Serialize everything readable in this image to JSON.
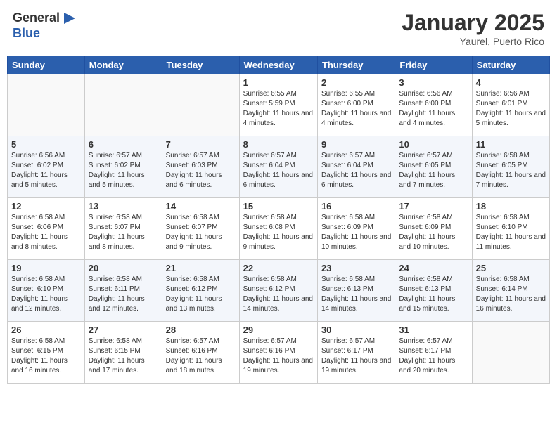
{
  "header": {
    "logo_general": "General",
    "logo_blue": "Blue",
    "month_title": "January 2025",
    "location": "Yaurel, Puerto Rico"
  },
  "weekdays": [
    "Sunday",
    "Monday",
    "Tuesday",
    "Wednesday",
    "Thursday",
    "Friday",
    "Saturday"
  ],
  "weeks": [
    [
      {
        "day": "",
        "info": ""
      },
      {
        "day": "",
        "info": ""
      },
      {
        "day": "",
        "info": ""
      },
      {
        "day": "1",
        "info": "Sunrise: 6:55 AM\nSunset: 5:59 PM\nDaylight: 11 hours and 4 minutes."
      },
      {
        "day": "2",
        "info": "Sunrise: 6:55 AM\nSunset: 6:00 PM\nDaylight: 11 hours and 4 minutes."
      },
      {
        "day": "3",
        "info": "Sunrise: 6:56 AM\nSunset: 6:00 PM\nDaylight: 11 hours and 4 minutes."
      },
      {
        "day": "4",
        "info": "Sunrise: 6:56 AM\nSunset: 6:01 PM\nDaylight: 11 hours and 5 minutes."
      }
    ],
    [
      {
        "day": "5",
        "info": "Sunrise: 6:56 AM\nSunset: 6:02 PM\nDaylight: 11 hours and 5 minutes."
      },
      {
        "day": "6",
        "info": "Sunrise: 6:57 AM\nSunset: 6:02 PM\nDaylight: 11 hours and 5 minutes."
      },
      {
        "day": "7",
        "info": "Sunrise: 6:57 AM\nSunset: 6:03 PM\nDaylight: 11 hours and 6 minutes."
      },
      {
        "day": "8",
        "info": "Sunrise: 6:57 AM\nSunset: 6:04 PM\nDaylight: 11 hours and 6 minutes."
      },
      {
        "day": "9",
        "info": "Sunrise: 6:57 AM\nSunset: 6:04 PM\nDaylight: 11 hours and 6 minutes."
      },
      {
        "day": "10",
        "info": "Sunrise: 6:57 AM\nSunset: 6:05 PM\nDaylight: 11 hours and 7 minutes."
      },
      {
        "day": "11",
        "info": "Sunrise: 6:58 AM\nSunset: 6:05 PM\nDaylight: 11 hours and 7 minutes."
      }
    ],
    [
      {
        "day": "12",
        "info": "Sunrise: 6:58 AM\nSunset: 6:06 PM\nDaylight: 11 hours and 8 minutes."
      },
      {
        "day": "13",
        "info": "Sunrise: 6:58 AM\nSunset: 6:07 PM\nDaylight: 11 hours and 8 minutes."
      },
      {
        "day": "14",
        "info": "Sunrise: 6:58 AM\nSunset: 6:07 PM\nDaylight: 11 hours and 9 minutes."
      },
      {
        "day": "15",
        "info": "Sunrise: 6:58 AM\nSunset: 6:08 PM\nDaylight: 11 hours and 9 minutes."
      },
      {
        "day": "16",
        "info": "Sunrise: 6:58 AM\nSunset: 6:09 PM\nDaylight: 11 hours and 10 minutes."
      },
      {
        "day": "17",
        "info": "Sunrise: 6:58 AM\nSunset: 6:09 PM\nDaylight: 11 hours and 10 minutes."
      },
      {
        "day": "18",
        "info": "Sunrise: 6:58 AM\nSunset: 6:10 PM\nDaylight: 11 hours and 11 minutes."
      }
    ],
    [
      {
        "day": "19",
        "info": "Sunrise: 6:58 AM\nSunset: 6:10 PM\nDaylight: 11 hours and 12 minutes."
      },
      {
        "day": "20",
        "info": "Sunrise: 6:58 AM\nSunset: 6:11 PM\nDaylight: 11 hours and 12 minutes."
      },
      {
        "day": "21",
        "info": "Sunrise: 6:58 AM\nSunset: 6:12 PM\nDaylight: 11 hours and 13 minutes."
      },
      {
        "day": "22",
        "info": "Sunrise: 6:58 AM\nSunset: 6:12 PM\nDaylight: 11 hours and 14 minutes."
      },
      {
        "day": "23",
        "info": "Sunrise: 6:58 AM\nSunset: 6:13 PM\nDaylight: 11 hours and 14 minutes."
      },
      {
        "day": "24",
        "info": "Sunrise: 6:58 AM\nSunset: 6:13 PM\nDaylight: 11 hours and 15 minutes."
      },
      {
        "day": "25",
        "info": "Sunrise: 6:58 AM\nSunset: 6:14 PM\nDaylight: 11 hours and 16 minutes."
      }
    ],
    [
      {
        "day": "26",
        "info": "Sunrise: 6:58 AM\nSunset: 6:15 PM\nDaylight: 11 hours and 16 minutes."
      },
      {
        "day": "27",
        "info": "Sunrise: 6:58 AM\nSunset: 6:15 PM\nDaylight: 11 hours and 17 minutes."
      },
      {
        "day": "28",
        "info": "Sunrise: 6:57 AM\nSunset: 6:16 PM\nDaylight: 11 hours and 18 minutes."
      },
      {
        "day": "29",
        "info": "Sunrise: 6:57 AM\nSunset: 6:16 PM\nDaylight: 11 hours and 19 minutes."
      },
      {
        "day": "30",
        "info": "Sunrise: 6:57 AM\nSunset: 6:17 PM\nDaylight: 11 hours and 19 minutes."
      },
      {
        "day": "31",
        "info": "Sunrise: 6:57 AM\nSunset: 6:17 PM\nDaylight: 11 hours and 20 minutes."
      },
      {
        "day": "",
        "info": ""
      }
    ]
  ]
}
